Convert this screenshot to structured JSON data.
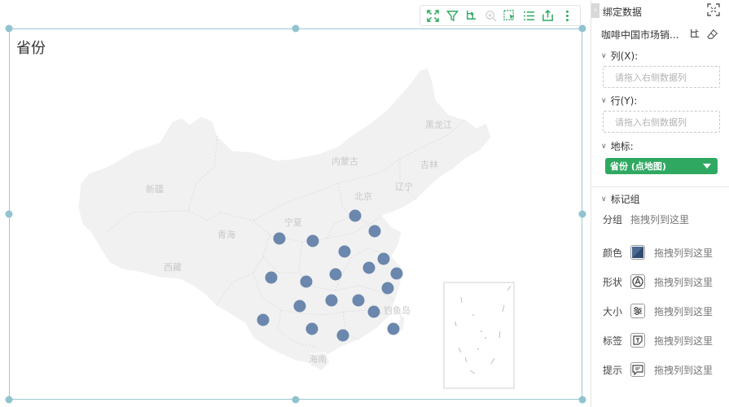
{
  "map": {
    "title": "省份",
    "regions": {
      "xinjiang": "新疆",
      "xizang": "西藏",
      "qinghai": "青海",
      "neimenggu": "内蒙古",
      "heilongjiang": "黑龙江",
      "jilin": "吉林",
      "liaoning": "辽宁",
      "beijing": "北京",
      "ningxia": "宁夏",
      "diaoyudao": "钓鱼岛",
      "hainan": "海南"
    },
    "point_color": "#6b87ad",
    "land_color": "#f1f1f1"
  },
  "toolbar": {
    "icons": [
      "fullscreen-icon",
      "filter-icon",
      "drill-icon",
      "zoom-icon",
      "select-icon",
      "list-icon",
      "export-icon",
      "more-icon"
    ],
    "accent": "#2fa962"
  },
  "panel": {
    "title": "绑定数据",
    "dataset_name": "咖啡中国市场销...",
    "columns_label": "列(X):",
    "columns_placeholder": "请拖入右侧数据列",
    "rows_label": "行(Y):",
    "rows_placeholder": "请拖入右侧数据列",
    "geo_label": "地标:",
    "geo_field": "省份 (点地图)",
    "mark_group_label": "标记组",
    "group_label": "分组",
    "drag_hint": "拖拽列到这里",
    "props": [
      {
        "label": "颜色",
        "hint": "拖拽列到这里",
        "icon": "color-icon"
      },
      {
        "label": "形状",
        "hint": "拖拽列到这里",
        "icon": "shape-icon"
      },
      {
        "label": "大小",
        "hint": "拖拽列到这里",
        "icon": "size-icon"
      },
      {
        "label": "标签",
        "hint": "拖拽列到这里",
        "icon": "label-icon"
      },
      {
        "label": "提示",
        "hint": "拖拽列到这里",
        "icon": "tooltip-icon"
      }
    ]
  }
}
